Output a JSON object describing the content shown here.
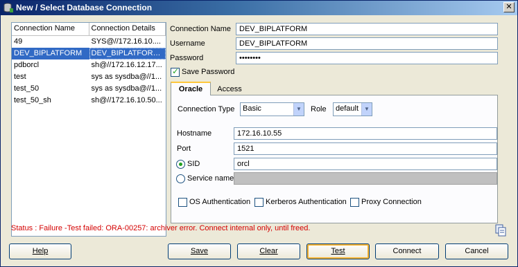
{
  "window": {
    "title": "New / Select Database Connection",
    "close_glyph": "✕"
  },
  "connections": {
    "columns": [
      "Connection Name",
      "Connection Details"
    ],
    "rows": [
      {
        "name": "49",
        "details": "SYS@//172.16.10...."
      },
      {
        "name": "DEV_BIPLATFORM",
        "details": "DEV_BIPLATFORM...."
      },
      {
        "name": "pdborcl",
        "details": "sh@//172.16.12.17..."
      },
      {
        "name": "test",
        "details": "sys as sysdba@//1..."
      },
      {
        "name": "test_50",
        "details": "sys as sysdba@//1..."
      },
      {
        "name": "test_50_sh",
        "details": "sh@//172.16.10.50..."
      }
    ],
    "selected_index": 1
  },
  "form": {
    "connection_name_label": "Connection Name",
    "connection_name_value": "DEV_BIPLATFORM",
    "username_label": "Username",
    "username_value": "DEV_BIPLATFORM",
    "password_label": "Password",
    "password_value": "••••••••",
    "save_password_label": "Save Password",
    "save_password_checked": true
  },
  "tabs": [
    {
      "label": "Oracle",
      "active": true
    },
    {
      "label": "Access",
      "active": false
    }
  ],
  "oracle": {
    "connection_type_label": "Connection Type",
    "connection_type_value": "Basic",
    "role_label": "Role",
    "role_value": "default",
    "hostname_label": "Hostname",
    "hostname_value": "172.16.10.55",
    "port_label": "Port",
    "port_value": "1521",
    "sid_label": "SID",
    "sid_value": "orcl",
    "service_name_label": "Service name",
    "service_name_value": "",
    "selected_option": "SID",
    "os_auth_label": "OS Authentication",
    "kerberos_auth_label": "Kerberos Authentication",
    "proxy_conn_label": "Proxy Connection"
  },
  "status": "Status : Failure -Test failed: ORA-00257: archiver error. Connect internal only, until freed.",
  "buttons": {
    "help": "Help",
    "save": "Save",
    "clear": "Clear",
    "test": "Test",
    "connect": "Connect",
    "cancel": "Cancel"
  },
  "colors": {
    "status_text": "#d40000",
    "selection": "#316ac5",
    "title_bar": "#0a246a"
  }
}
